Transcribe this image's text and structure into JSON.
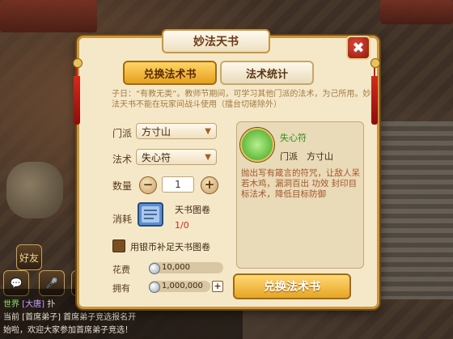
{
  "dialog": {
    "title": "妙法天书",
    "close_label": "✖",
    "tabs": [
      "兑换法术书",
      "法术统计"
    ],
    "description": "子日：“有教无类”。教师节期间，可学习其他门派的法术，为己所用。妙法天书不能在玩家间战斗使用（擂台切磋除外）"
  },
  "form": {
    "school_label": "门派",
    "school_value": "方寸山",
    "spell_label": "法术",
    "spell_value": "失心符",
    "quantity_label": "数量",
    "quantity_value": "1",
    "minus": "−",
    "plus": "+",
    "cost_label": "消耗",
    "cost_item": "天书图卷",
    "cost_count": "1/0",
    "use_silver_label": "用银币补足天书图卷",
    "fee_label": "花费",
    "fee_value": "10,000",
    "owned_label": "拥有",
    "owned_value": "1,000,000",
    "owned_plus": "+"
  },
  "spell_info": {
    "name": "失心符",
    "school": "门派　方寸山",
    "description": "抛出写有箴言的符咒，让敌人呆若木鸡，漏洞百出 功效 封印目标法术，降低目标防御"
  },
  "exchange_button": "兑换法术书",
  "chat": {
    "line1_channel": "世界",
    "line1_name": "[大唐]",
    "line1_rest": "扑",
    "line2": "当前 [首席弟子] 首席弟子竞选报名开",
    "line3": "始啦，欢迎大家参加首席弟子竞选！"
  },
  "hud": {
    "label": "好友"
  }
}
